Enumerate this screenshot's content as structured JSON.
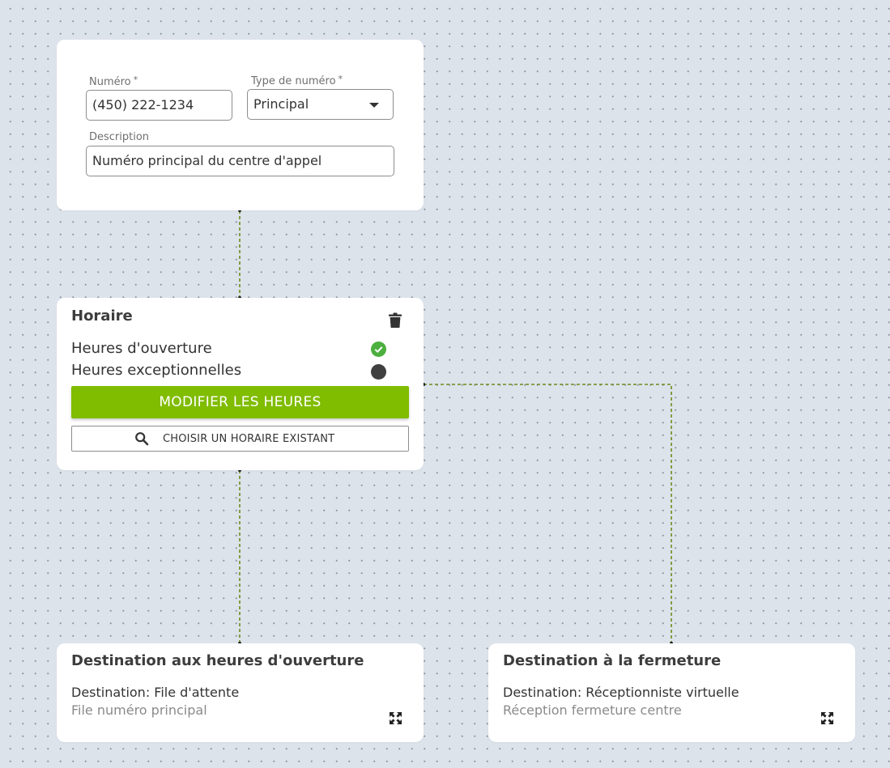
{
  "colors": {
    "accent": "#80bc00",
    "canvas": "#dde3eb",
    "edge": "#6f8a1a",
    "status_active": "#4caf3f",
    "status_inactive": "#404040"
  },
  "number_node": {
    "numero_label": "Numéro",
    "numero_required": "*",
    "numero_value": "(450) 222-1234",
    "type_label": "Type de numéro",
    "type_required": "*",
    "type_value": "Principal",
    "description_label": "Description",
    "description_value": "Numéro principal du centre d'appel"
  },
  "schedule_node": {
    "title": "Horaire",
    "delete_icon": "trash-icon",
    "rows": [
      {
        "label": "Heures d'ouverture",
        "status": "active",
        "icon": "check-circle-icon"
      },
      {
        "label": "Heures exceptionnelles",
        "status": "inactive",
        "icon": "dot-icon"
      }
    ],
    "edit_button": "MODIFIER LES HEURES",
    "choose_button": "CHOISIR UN HORAIRE EXISTANT",
    "choose_icon": "search-icon"
  },
  "open_destination_node": {
    "title": "Destination aux heures d'ouverture",
    "destination": "Destination: File d'attente",
    "detail": "File numéro principal",
    "expand_icon": "expand-icon"
  },
  "closed_destination_node": {
    "title": "Destination à la fermeture",
    "destination": "Destination: Réceptionniste virtuelle",
    "detail": "Réception fermeture centre",
    "expand_icon": "expand-icon"
  }
}
